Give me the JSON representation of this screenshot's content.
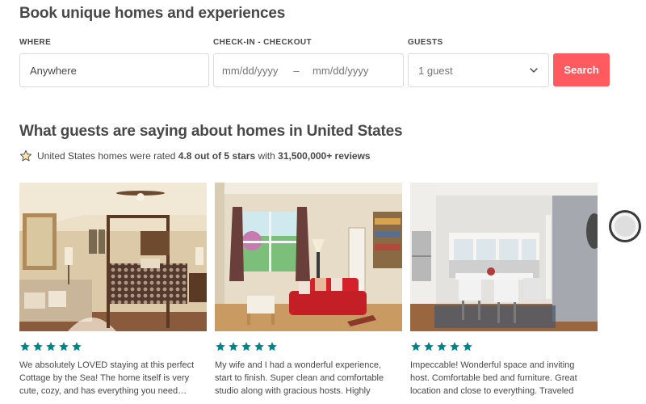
{
  "hero": {
    "title": "Book unique homes and experiences"
  },
  "search": {
    "where_label": "WHERE",
    "where_placeholder": "Anywhere",
    "dates_label": "CHECK-IN - CHECKOUT",
    "checkin_placeholder": "mm/dd/yyyy",
    "date_separator": "–",
    "checkout_placeholder": "mm/dd/yyyy",
    "guests_label": "GUESTS",
    "guests_value": "1 guest",
    "search_button": "Search"
  },
  "reviews_section": {
    "title": "What guests are saying about homes in United States",
    "rating_prefix": "United States homes were rated ",
    "rating_value": "4.8 out of 5 stars",
    "rating_middle": " with ",
    "review_count": "31,500,000+ reviews",
    "cards": [
      {
        "image": "bedroom-photo",
        "stars": 5,
        "text": "We absolutely LOVED staying at this perfect Cottage by the Sea! The home itself is very cute, cozy, and has everything you need… even"
      },
      {
        "image": "living-room-photo",
        "stars": 5,
        "text": "My wife and I had a wonderful experience, start to finish. Super clean and comfortable studio along with gracious hosts. Highly"
      },
      {
        "image": "kitchen-dining-photo",
        "stars": 5,
        "text": "Impeccable! Wonderful space and inviting host. Comfortable bed and furniture. Great location and close to everything. Traveled"
      }
    ]
  },
  "colors": {
    "accent": "#ff5a5f",
    "star_teal": "#008489",
    "text": "#484848"
  },
  "icons": {
    "rating_icon": "star-outline-icon",
    "guests_dropdown": "chevron-down-icon"
  }
}
